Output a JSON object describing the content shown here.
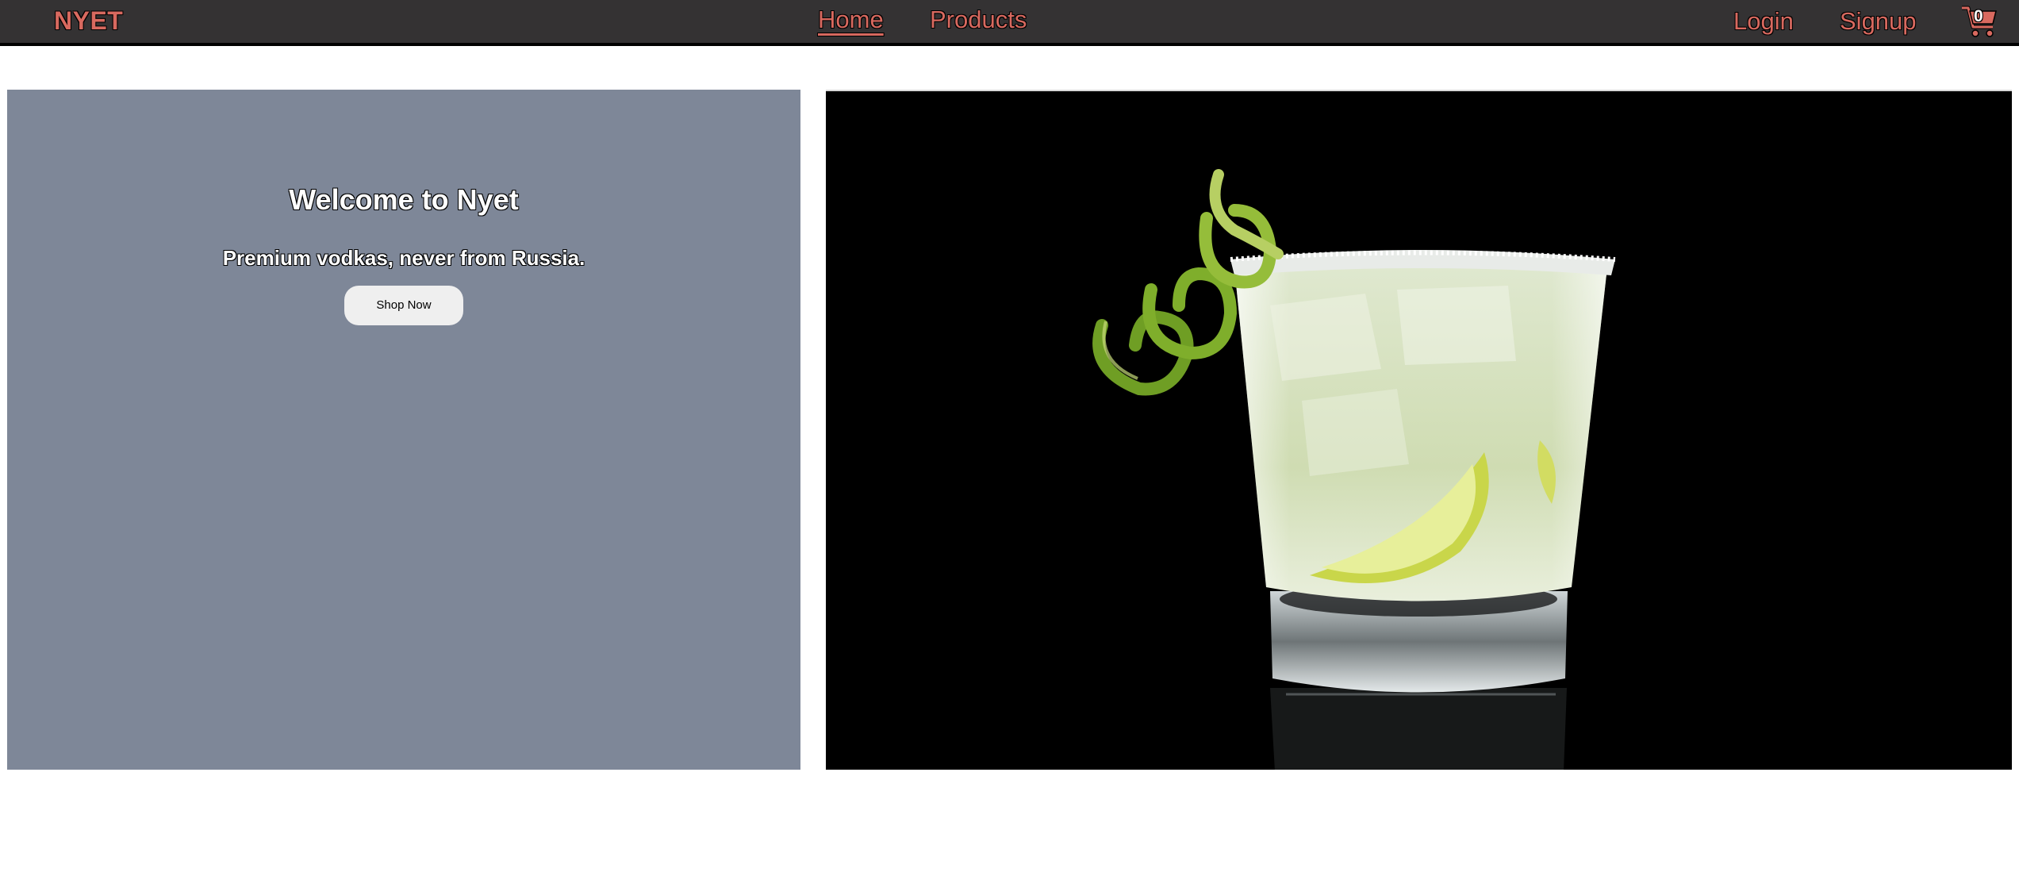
{
  "navbar": {
    "brand": "NYET",
    "links": [
      {
        "label": "Home",
        "active": true
      },
      {
        "label": "Products",
        "active": false
      }
    ],
    "login_label": "Login",
    "signup_label": "Signup",
    "cart": {
      "icon": "shopping-cart-icon",
      "count": "0"
    }
  },
  "hero": {
    "title": "Welcome to Nyet",
    "subtitle": "Premium vodkas, never from Russia.",
    "button_label": "Shop Now"
  },
  "feature_image": {
    "subject": "cocktail glass with lime wedge, lime peel twist and salted rim"
  },
  "colors": {
    "nav_background": "#343233",
    "nav_text": "#d8695f",
    "hero_panel": "#7e8798",
    "button_background": "#efefef",
    "image_background": "#000000"
  }
}
